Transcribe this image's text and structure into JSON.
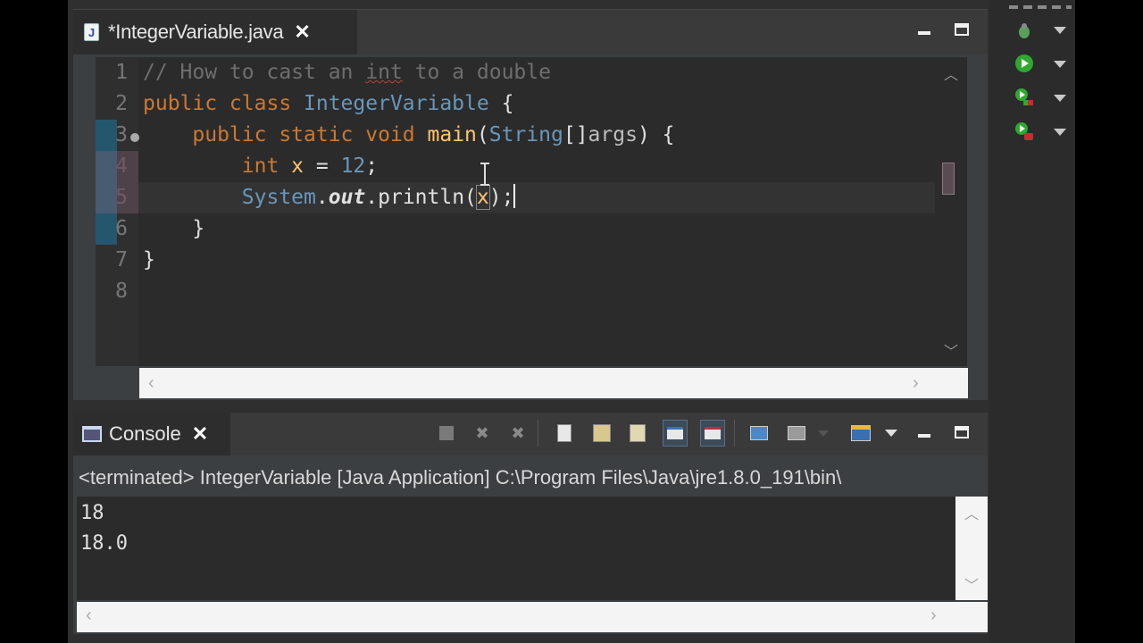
{
  "editor": {
    "tab_label": "*IntegerVariable.java",
    "tab_icon_letter": "J",
    "close_glyph": "✕",
    "line_numbers": [
      "1",
      "2",
      "3",
      "4",
      "5",
      "6",
      "7",
      "8"
    ],
    "lines": {
      "l1_comment_a": "// How to cast an ",
      "l1_comment_int": "int",
      "l1_comment_b": " to a double",
      "l2_kw": "public class ",
      "l2_cls": "IntegerVariable",
      "l2_rest": " {",
      "l3_indent": "    ",
      "l3_kw": "public static void ",
      "l3_fn": "main",
      "l3_paren": "(",
      "l3_typ": "String",
      "l3_br": "[]",
      "l3_arg": "args",
      "l3_rest": ") {",
      "l4_indent": "        ",
      "l4_kw": "int ",
      "l4_var": "x",
      "l4_eq": " = ",
      "l4_num": "12",
      "l4_semi": ";",
      "l5_indent": "        ",
      "l5_sys": "System",
      "l5_dot1": ".",
      "l5_out": "out",
      "l5_call": ".println(",
      "l5_x": "x",
      "l5_end": ");",
      "l6": "    }",
      "l7": "}"
    }
  },
  "console": {
    "tab_label": "Console",
    "close_glyph": "✕",
    "status": "<terminated> IntegerVariable [Java Application] C:\\Program Files\\Java\\jre1.8.0_191\\bin\\",
    "output": [
      "18",
      "18.0"
    ]
  },
  "colors": {
    "keyword": "#cc7832",
    "class_name": "#6897bb",
    "method": "#ffc66d",
    "number": "#6897bb",
    "comment": "#6e6e6e",
    "editor_bg": "#2b2b2b"
  }
}
